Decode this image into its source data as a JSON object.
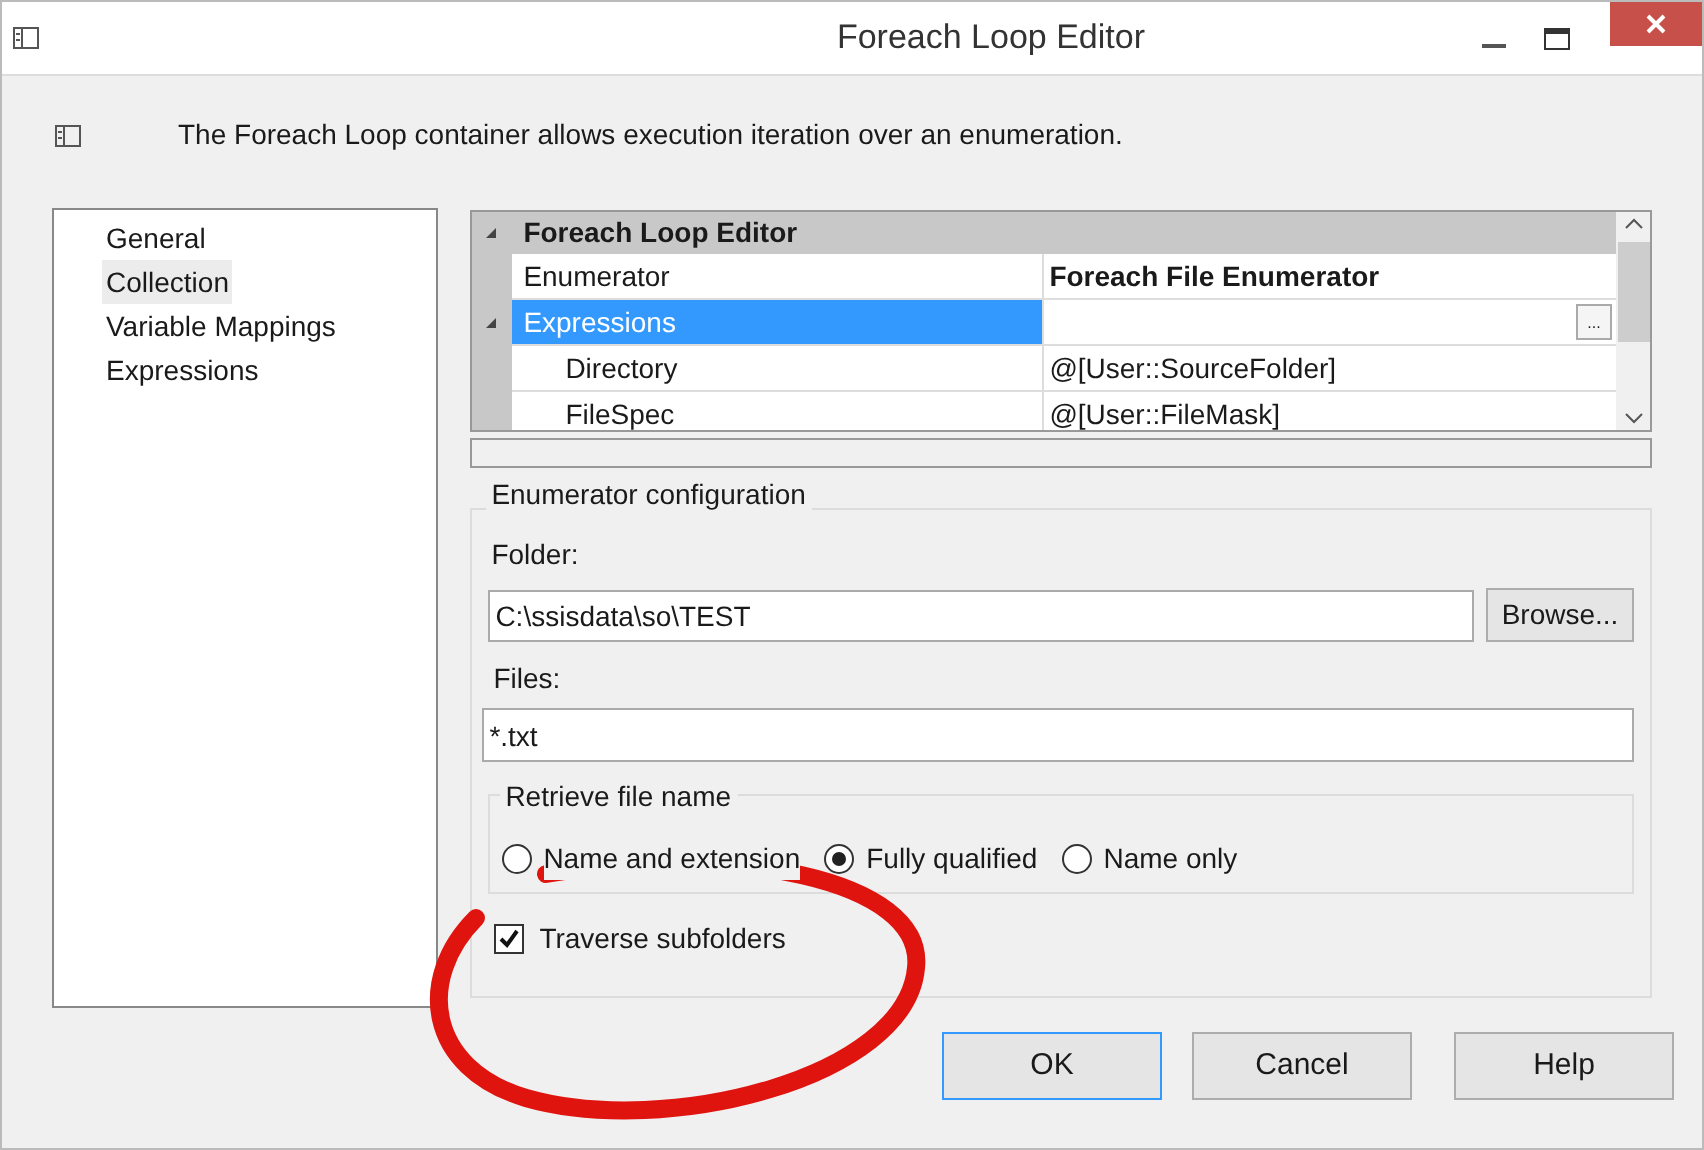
{
  "window": {
    "title": "Foreach Loop Editor"
  },
  "description": "The Foreach Loop container allows execution iteration over an enumeration.",
  "sidebar": {
    "items": [
      {
        "label": "General",
        "selected": false
      },
      {
        "label": "Collection",
        "selected": true
      },
      {
        "label": "Variable Mappings",
        "selected": false
      },
      {
        "label": "Expressions",
        "selected": false
      }
    ]
  },
  "property_grid": {
    "category": "Foreach Loop Editor",
    "expanded": true,
    "rows": [
      {
        "name": "Enumerator",
        "value": "Foreach File Enumerator",
        "bold_value": true,
        "selected": false,
        "expanded": false,
        "children": []
      },
      {
        "name": "Expressions",
        "value": "",
        "bold_value": false,
        "selected": true,
        "expanded": true,
        "button": "...",
        "children": [
          {
            "name": "Directory",
            "value": "@[User::SourceFolder]"
          },
          {
            "name": "FileSpec",
            "value": "@[User::FileMask]"
          }
        ]
      }
    ]
  },
  "enumerator_configuration": {
    "title": "Enumerator configuration",
    "folder": {
      "label": "Folder:",
      "value": "C:\\ssisdata\\so\\TEST",
      "button": "Browse..."
    },
    "files": {
      "label": "Files:",
      "value": "*.txt"
    },
    "retrieve_file_name": {
      "title": "Retrieve file name",
      "options": [
        {
          "label": "Name and extension",
          "selected": false
        },
        {
          "label": "Fully qualified",
          "selected": true
        },
        {
          "label": "Name only",
          "selected": false
        }
      ]
    },
    "traverse_subfolders": {
      "label": "Traverse subfolders",
      "checked": true
    }
  },
  "buttons": [
    "OK",
    "Cancel",
    "Help"
  ]
}
